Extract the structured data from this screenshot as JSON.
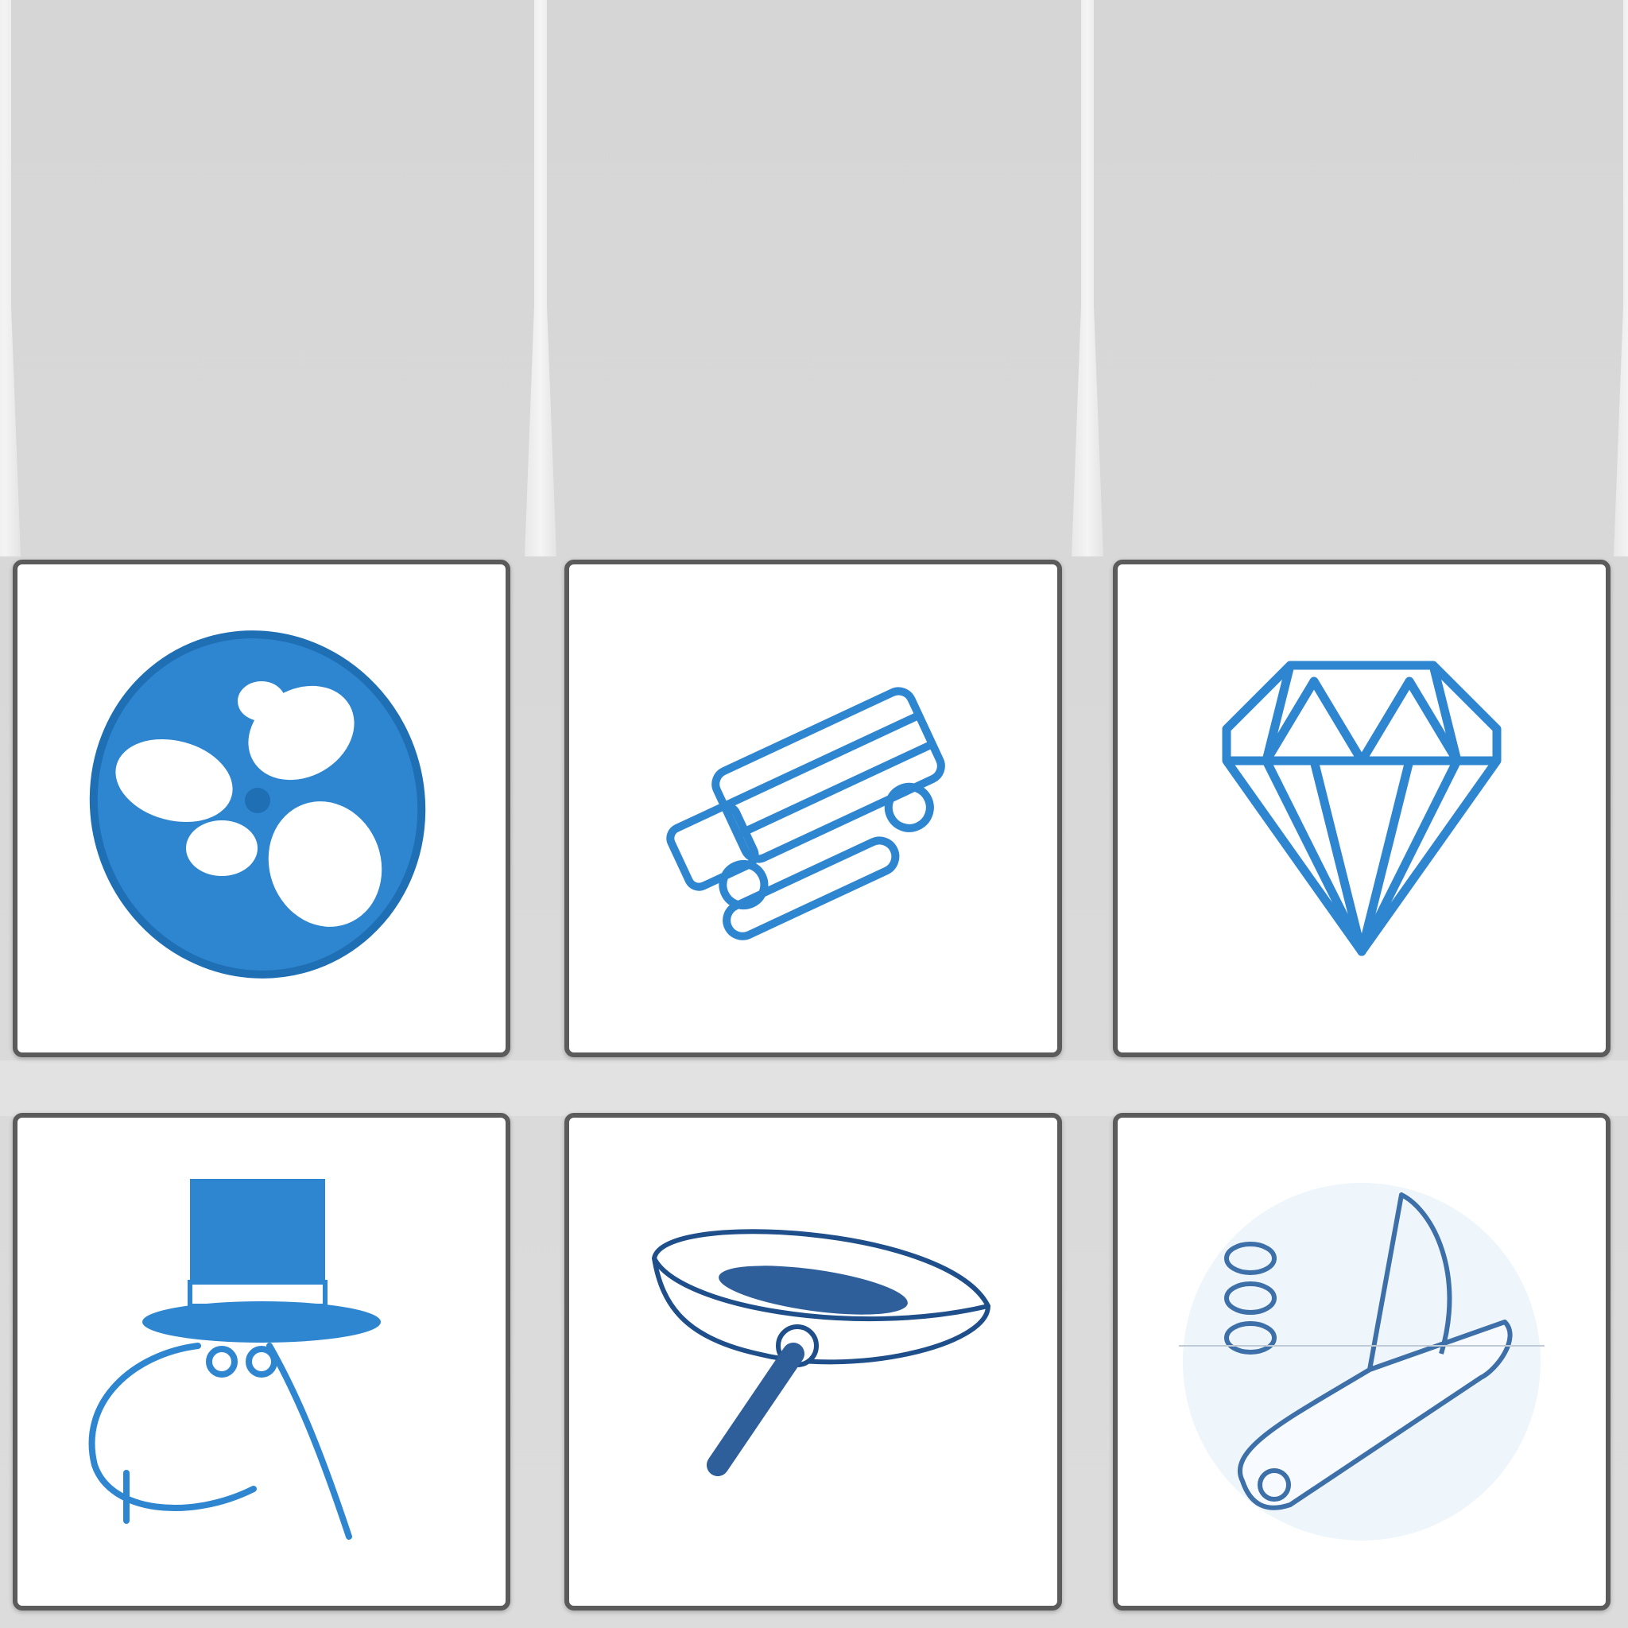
{
  "board": {
    "columns": 3,
    "empty_rows": 1,
    "tiles": [
      {
        "icon": "butterfly-coin-icon"
      },
      {
        "icon": "lying-bus-icon"
      },
      {
        "icon": "diamond-icon"
      },
      {
        "icon": "top-hat-character-icon"
      },
      {
        "icon": "frying-pan-icon"
      },
      {
        "icon": "pocket-knife-icon"
      }
    ]
  },
  "colors": {
    "icon_blue": "#2f86d0",
    "tile_border": "#5b5b5b",
    "board_bg": "#d9d9d9"
  }
}
